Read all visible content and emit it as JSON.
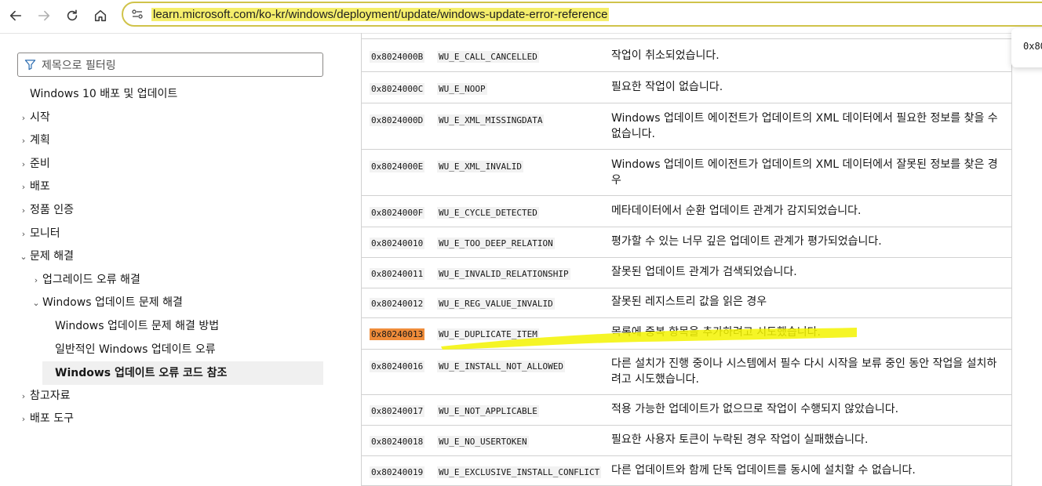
{
  "browser": {
    "url": "learn.microsoft.com/ko-kr/windows/deployment/update/windows-update-error-reference"
  },
  "sidebar": {
    "filter_placeholder": "제목으로 필터링",
    "items": [
      {
        "label": "Windows 10 배포 및 업데이트",
        "chevron": ""
      },
      {
        "label": "시작",
        "chevron": "›"
      },
      {
        "label": "계획",
        "chevron": "›"
      },
      {
        "label": "준비",
        "chevron": "›"
      },
      {
        "label": "배포",
        "chevron": "›"
      },
      {
        "label": "정품 인증",
        "chevron": "›"
      },
      {
        "label": "모니터",
        "chevron": "›"
      },
      {
        "label": "문제 해결",
        "chevron": "⌄"
      },
      {
        "label": "업그레이드 오류 해결",
        "chevron": "›"
      },
      {
        "label": "Windows 업데이트 문제 해결",
        "chevron": "⌄"
      },
      {
        "label": "Windows 업데이트 문제 해결 방법",
        "chevron": ""
      },
      {
        "label": "일반적인 Windows 업데이트 오류",
        "chevron": ""
      },
      {
        "label": "Windows 업데이트 오류 코드 참조",
        "chevron": ""
      },
      {
        "label": "참고자료",
        "chevron": "›"
      },
      {
        "label": "배포 도구",
        "chevron": "›"
      }
    ]
  },
  "table": {
    "rows": [
      {
        "code": "0x8024000B",
        "name": "WU_E_CALL_CANCELLED",
        "desc": "작업이 취소되었습니다."
      },
      {
        "code": "0x8024000C",
        "name": "WU_E_NOOP",
        "desc": "필요한 작업이 없습니다."
      },
      {
        "code": "0x8024000D",
        "name": "WU_E_XML_MISSINGDATA",
        "desc": "Windows 업데이트 에이전트가 업데이트의 XML 데이터에서 필요한 정보를 찾을 수 없습니다."
      },
      {
        "code": "0x8024000E",
        "name": "WU_E_XML_INVALID",
        "desc": "Windows 업데이트 에이전트가 업데이트의 XML 데이터에서 잘못된 정보를 찾은 경우"
      },
      {
        "code": "0x8024000F",
        "name": "WU_E_CYCLE_DETECTED",
        "desc": "메타데이터에서 순환 업데이트 관계가 감지되었습니다."
      },
      {
        "code": "0x80240010",
        "name": "WU_E_TOO_DEEP_RELATION",
        "desc": "평가할 수 있는 너무 깊은 업데이트 관계가 평가되었습니다."
      },
      {
        "code": "0x80240011",
        "name": "WU_E_INVALID_RELATIONSHIP",
        "desc": "잘못된 업데이트 관계가 검색되었습니다."
      },
      {
        "code": "0x80240012",
        "name": "WU_E_REG_VALUE_INVALID",
        "desc": "잘못된 레지스트리 값을 읽은 경우"
      },
      {
        "code": "0x80240013",
        "name": "WU_E_DUPLICATE_ITEM",
        "desc": "목록에 중복 항목을 추가하려고 시도했습니다."
      },
      {
        "code": "0x80240016",
        "name": "WU_E_INSTALL_NOT_ALLOWED",
        "desc": "다른 설치가 진행 중이나 시스템에서 필수 다시 시작을 보류 중인 동안 작업을 설치하려고 시도했습니다."
      },
      {
        "code": "0x80240017",
        "name": "WU_E_NOT_APPLICABLE",
        "desc": "적용 가능한 업데이트가 없으므로 작업이 수행되지 않았습니다."
      },
      {
        "code": "0x80240018",
        "name": "WU_E_NO_USERTOKEN",
        "desc": "필요한 사용자 토큰이 누락된 경우 작업이 실패했습니다."
      },
      {
        "code": "0x80240019",
        "name": "WU_E_EXCLUSIVE_INSTALL_CONFLICT",
        "desc": "다른 업데이트와 함께 단독 업데이트를 동시에 설치할 수 없습니다."
      }
    ]
  },
  "tooltip": {
    "text": "0x80"
  },
  "colors": {
    "code_highlight": "#ef8c3a",
    "marker": "#f3f300",
    "url_highlight": "#f5ee6b"
  }
}
